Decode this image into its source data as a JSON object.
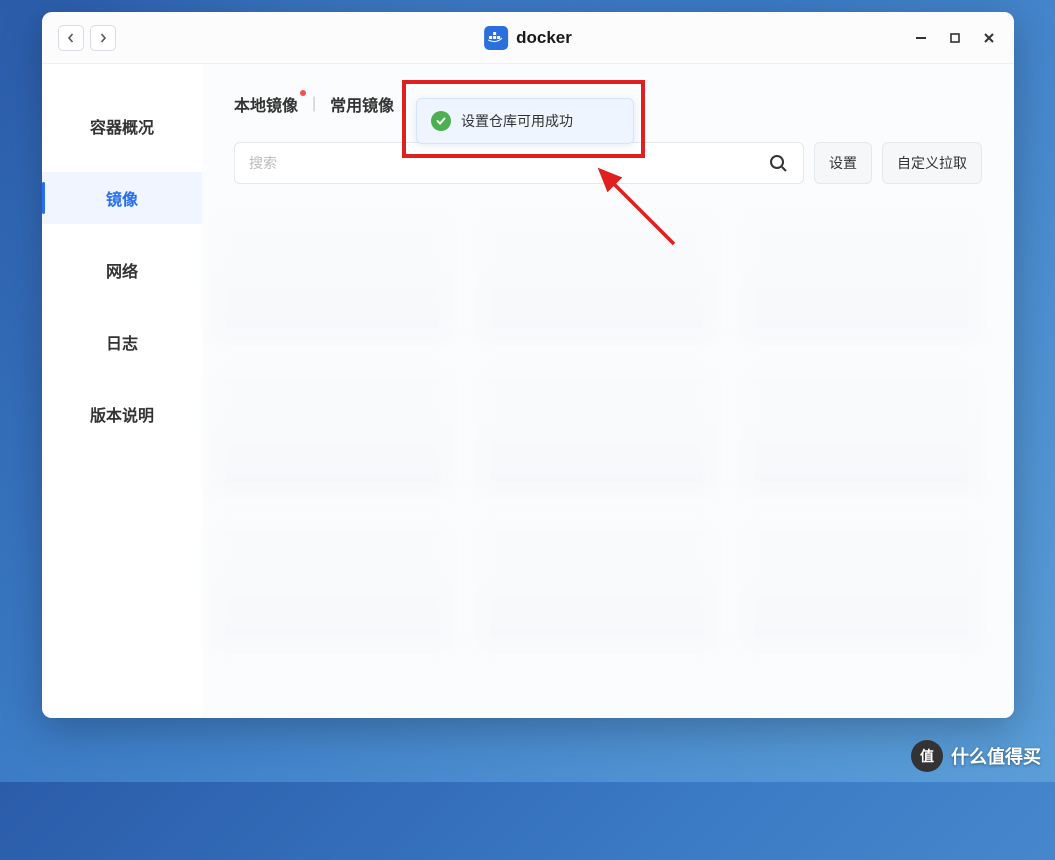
{
  "titlebar": {
    "title": "docker"
  },
  "sidebar": {
    "items": [
      {
        "label": "容器概况"
      },
      {
        "label": "镜像"
      },
      {
        "label": "网络"
      },
      {
        "label": "日志"
      },
      {
        "label": "版本说明"
      }
    ]
  },
  "tabs": [
    {
      "label": "本地镜像",
      "has_notif": true
    },
    {
      "label": "常用镜像"
    }
  ],
  "search": {
    "placeholder": "搜索"
  },
  "buttons": {
    "settings": "设置",
    "custom_pull": "自定义拉取"
  },
  "toast": {
    "message": "设置仓库可用成功"
  },
  "watermark": {
    "badge": "值",
    "text": "什么值得买"
  }
}
